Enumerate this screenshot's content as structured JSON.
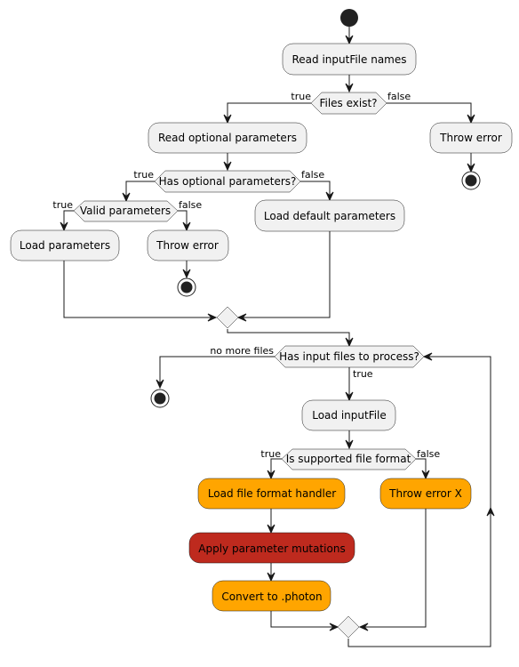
{
  "diagram": {
    "type": "activity",
    "colors": {
      "default_fill": "#F1F1F1",
      "orange_fill": "#FFA500",
      "red_fill": "#BE2A1E",
      "line": "#181818",
      "start_end": "#222222"
    },
    "nodes": {
      "read_names": "Read inputFile names",
      "files_exist": "Files exist?",
      "read_optional": "Read optional parameters",
      "throw_error_1": "Throw error",
      "has_optional": "Has optional parameters?",
      "valid_params": "Valid parameters",
      "load_default": "Load default parameters",
      "load_params": "Load parameters",
      "throw_error_2": "Throw error",
      "has_input": "Has input files to process?",
      "load_input": "Load inputFile",
      "is_supported": "Is supported file format",
      "load_handler": "Load file format handler",
      "throw_error_x": "Throw error X",
      "apply_mutations": "Apply parameter mutations",
      "convert": "Convert to .photon"
    },
    "edge_labels": {
      "files_exist_true": "true",
      "files_exist_false": "false",
      "has_optional_true": "true",
      "has_optional_false": "false",
      "valid_true": "true",
      "valid_false": "false",
      "no_more_files": "no more files",
      "has_input_true": "true",
      "supported_true": "true",
      "supported_false": "false"
    }
  }
}
